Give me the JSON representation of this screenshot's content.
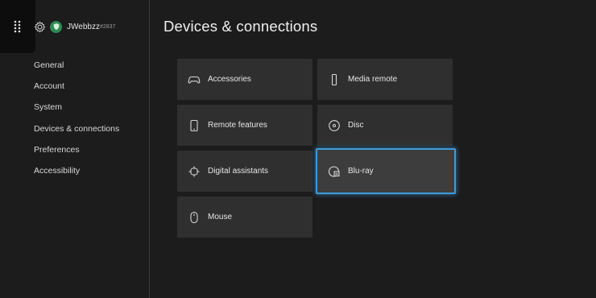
{
  "profile": {
    "gamertag": "JWebbzz",
    "suffix": "#2837"
  },
  "sidebar": {
    "items": [
      {
        "label": "General"
      },
      {
        "label": "Account"
      },
      {
        "label": "System"
      },
      {
        "label": "Devices & connections"
      },
      {
        "label": "Preferences"
      },
      {
        "label": "Accessibility"
      }
    ]
  },
  "page": {
    "title": "Devices & connections"
  },
  "tiles": [
    {
      "label": "Accessories",
      "icon": "controller-icon"
    },
    {
      "label": "Media remote",
      "icon": "remote-icon"
    },
    {
      "label": "Remote features",
      "icon": "phone-icon"
    },
    {
      "label": "Disc",
      "icon": "disc-icon"
    },
    {
      "label": "Digital assistants",
      "icon": "assistant-icon"
    },
    {
      "label": "Blu-ray",
      "icon": "bluray-icon",
      "focused": true
    },
    {
      "label": "Mouse",
      "icon": "mouse-icon"
    }
  ],
  "colors": {
    "focus": "#3f9ad9",
    "tile": "#2f2f2f",
    "background": "#1c1c1c"
  }
}
